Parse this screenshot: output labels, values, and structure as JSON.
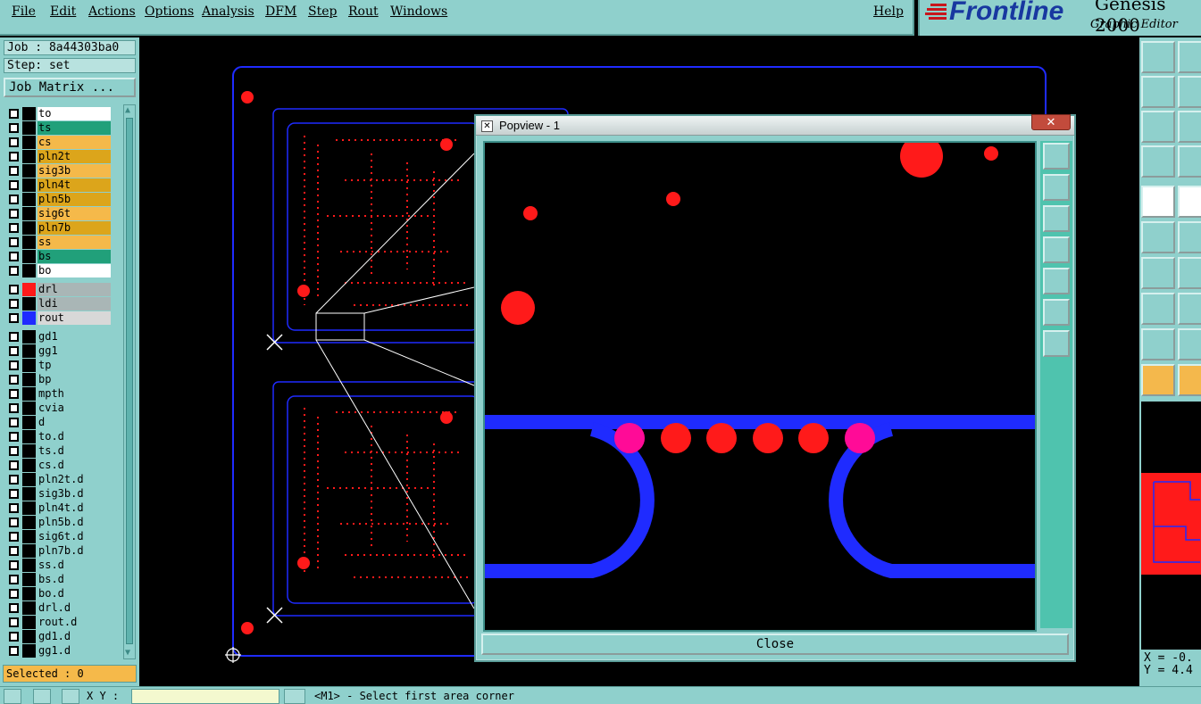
{
  "menu": [
    "File",
    "Edit",
    "Actions",
    "Options",
    "Analysis",
    "DFM",
    "Step",
    "Rout",
    "Windows"
  ],
  "help": "Help",
  "brand": {
    "logo": "Frontline",
    "product": "Genesis 2000",
    "subtitle": "Graphic Editor",
    "accent": "#c8161c",
    "logo_color": "#1838a0"
  },
  "job": {
    "job_label": "Job : 8a44303ba0",
    "step_label": "Step: set",
    "matrix_button": "Job Matrix ..."
  },
  "layers": [
    {
      "name": "to",
      "color": "#ffffff"
    },
    {
      "name": "ts",
      "color": "#21a07a"
    },
    {
      "name": "cs",
      "color": "#f5b94a"
    },
    {
      "name": "pln2t",
      "color": "#dca51b"
    },
    {
      "name": "sig3b",
      "color": "#f5b94a"
    },
    {
      "name": "pln4t",
      "color": "#dca51b"
    },
    {
      "name": "pln5b",
      "color": "#dca51b"
    },
    {
      "name": "sig6t",
      "color": "#f5b94a"
    },
    {
      "name": "pln7b",
      "color": "#dca51b"
    },
    {
      "name": "ss",
      "color": "#f5b94a"
    },
    {
      "name": "bs",
      "color": "#21a07a"
    },
    {
      "name": "bo",
      "color": "#ffffff"
    }
  ],
  "drill_layers": [
    {
      "name": "drl",
      "color": "#a9b6b6",
      "swatch": "#ff1a1a",
      "active": true
    },
    {
      "name": "ldi",
      "color": "#a9b6b6",
      "swatch": "#000000",
      "active": false
    },
    {
      "name": "rout",
      "color": "#d8d8d8",
      "swatch": "#1f2bff",
      "active": true
    }
  ],
  "misc_layers": [
    "gd1",
    "gg1",
    "tp",
    "bp",
    "mpth",
    "cvia",
    "d",
    "to.d",
    "ts.d",
    "cs.d",
    "pln2t.d",
    "sig3b.d",
    "pln4t.d",
    "pln5b.d",
    "sig6t.d",
    "pln7b.d",
    "ss.d",
    "bs.d",
    "bo.d",
    "drl.d",
    "rout.d",
    "gd1.d",
    "gg1.d"
  ],
  "selected": "Selected : 0",
  "status": {
    "xy_label": "X Y :",
    "prompt": "<M1> - Select first area corner"
  },
  "popup": {
    "title": "Popview - 1",
    "close": "Close"
  },
  "coords": {
    "x": "X = -0.",
    "y": "Y = 4.4"
  }
}
